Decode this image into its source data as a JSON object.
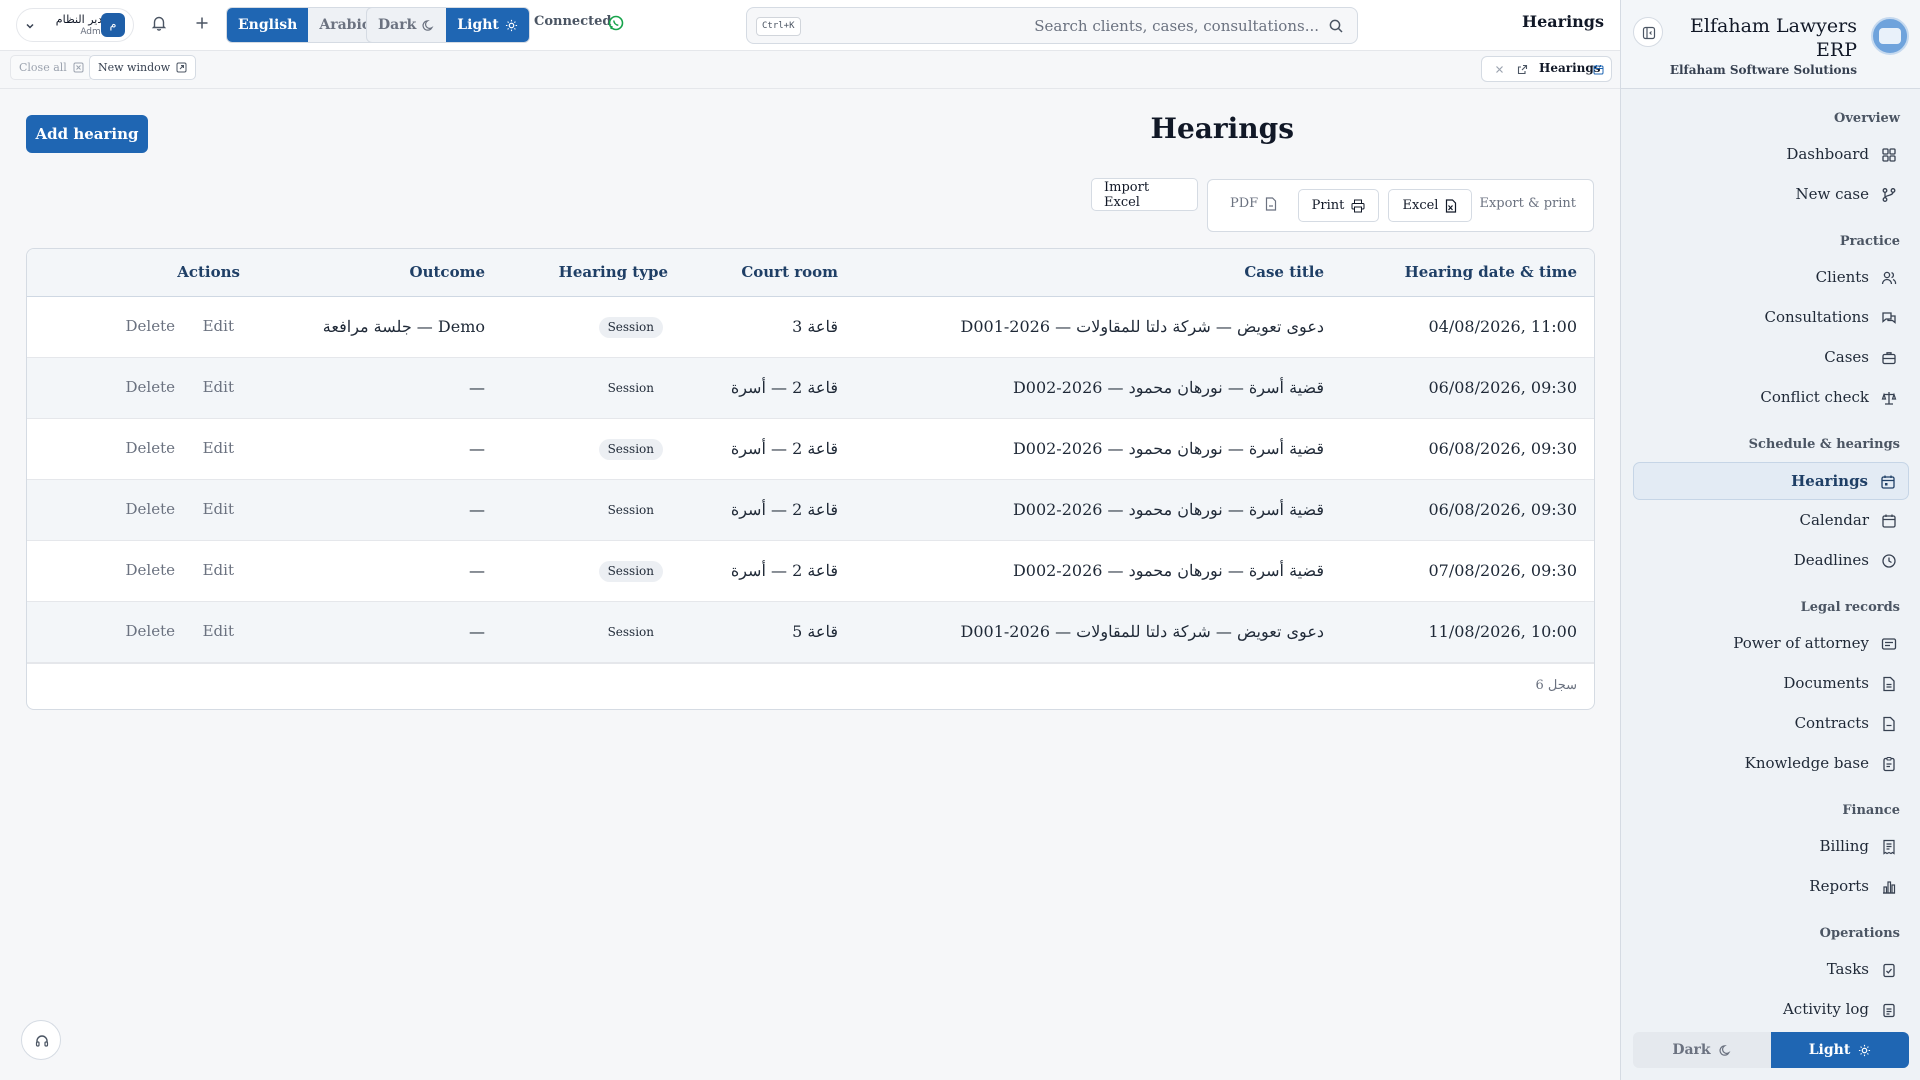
{
  "topbar": {
    "user": {
      "name": "مدير النظام",
      "role": "Admin",
      "initial": "م"
    },
    "language": {
      "english": "English",
      "arabic": "Arabic",
      "active": "english"
    },
    "theme": {
      "dark": "Dark",
      "light": "Light",
      "active": "light"
    },
    "status": "Connected",
    "search": {
      "shortcut": "Ctrl+K",
      "placeholder": "Search clients, cases, consultations..."
    },
    "title": "Hearings"
  },
  "tabbar": {
    "close_all": "Close all",
    "new_window": "New window",
    "open_tab": "Hearings"
  },
  "page": {
    "title": "Hearings",
    "add_button": "Add hearing",
    "import_excel": "Import Excel",
    "export": {
      "label": "Export & print",
      "excel": "Excel",
      "print": "Print",
      "pdf": "PDF"
    }
  },
  "table": {
    "columns": {
      "date": "Hearing date & time",
      "case": "Case title",
      "room": "Court room",
      "type": "Hearing type",
      "outcome": "Outcome",
      "actions": "Actions"
    },
    "rows": [
      {
        "date": "04/08/2026, 11:00",
        "case": "D001-2026 — دعوى تعويض — شركة دلتا للمقاولات",
        "room": "قاعة 3",
        "type": "Session",
        "outcome": "جلسة مرافعة — Demo",
        "edit": "Edit",
        "delete": "Delete"
      },
      {
        "date": "06/08/2026, 09:30",
        "case": "D002-2026 — قضية أسرة — نورهان محمود",
        "room": "قاعة 2 — أسرة",
        "type": "Session",
        "outcome": "—",
        "edit": "Edit",
        "delete": "Delete"
      },
      {
        "date": "06/08/2026, 09:30",
        "case": "D002-2026 — قضية أسرة — نورهان محمود",
        "room": "قاعة 2 — أسرة",
        "type": "Session",
        "outcome": "—",
        "edit": "Edit",
        "delete": "Delete"
      },
      {
        "date": "06/08/2026, 09:30",
        "case": "D002-2026 — قضية أسرة — نورهان محمود",
        "room": "قاعة 2 — أسرة",
        "type": "Session",
        "outcome": "—",
        "edit": "Edit",
        "delete": "Delete"
      },
      {
        "date": "07/08/2026, 09:30",
        "case": "D002-2026 — قضية أسرة — نورهان محمود",
        "room": "قاعة 2 — أسرة",
        "type": "Session",
        "outcome": "—",
        "edit": "Edit",
        "delete": "Delete"
      },
      {
        "date": "11/08/2026, 10:00",
        "case": "D001-2026 — دعوى تعويض — شركة دلتا للمقاولات",
        "room": "قاعة 5",
        "type": "Session",
        "outcome": "—",
        "edit": "Edit",
        "delete": "Delete"
      }
    ],
    "footer_count": "6 سجل"
  },
  "sidebar": {
    "brand": "Elfaham Lawyers ERP",
    "subtitle": "Elfaham Software Solutions",
    "sections": {
      "overview": "Overview",
      "practice": "Practice",
      "schedule": "Schedule & hearings",
      "legal": "Legal records",
      "finance": "Finance",
      "operations": "Operations"
    },
    "items": {
      "dashboard": "Dashboard",
      "new_case": "New case",
      "clients": "Clients",
      "consultations": "Consultations",
      "cases": "Cases",
      "conflict_check": "Conflict check",
      "hearings": "Hearings",
      "calendar": "Calendar",
      "deadlines": "Deadlines",
      "power_of_attorney": "Power of attorney",
      "documents": "Documents",
      "contracts": "Contracts",
      "knowledge_base": "Knowledge base",
      "billing": "Billing",
      "reports": "Reports",
      "tasks": "Tasks",
      "activity_log": "Activity log"
    },
    "active_item": "hearings",
    "theme": {
      "dark": "Dark",
      "light": "Light",
      "active": "light"
    }
  },
  "colors": {
    "accent": "#1f66b3",
    "header_text": "#1f3f66",
    "connected": "#16a34a"
  }
}
